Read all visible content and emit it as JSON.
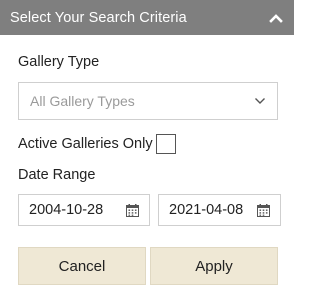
{
  "header": {
    "title": "Select Your Search Criteria",
    "collapse_icon": "chevron-up-icon"
  },
  "gallery_type": {
    "label": "Gallery Type",
    "selected": "All Gallery Types",
    "icon": "chevron-down-icon"
  },
  "active_only": {
    "label": "Active Galleries Only",
    "checked": false
  },
  "date_range": {
    "label": "Date Range",
    "from": "2004-10-28",
    "to": "2021-04-08",
    "icon": "calendar-icon"
  },
  "buttons": {
    "cancel_label": "Cancel",
    "apply_label": "Apply"
  },
  "colors": {
    "header_bg": "#7f7f7f",
    "button_bg": "#efe8d5",
    "field_border": "#cfcfcf",
    "placeholder_text": "#9a9a9a"
  }
}
